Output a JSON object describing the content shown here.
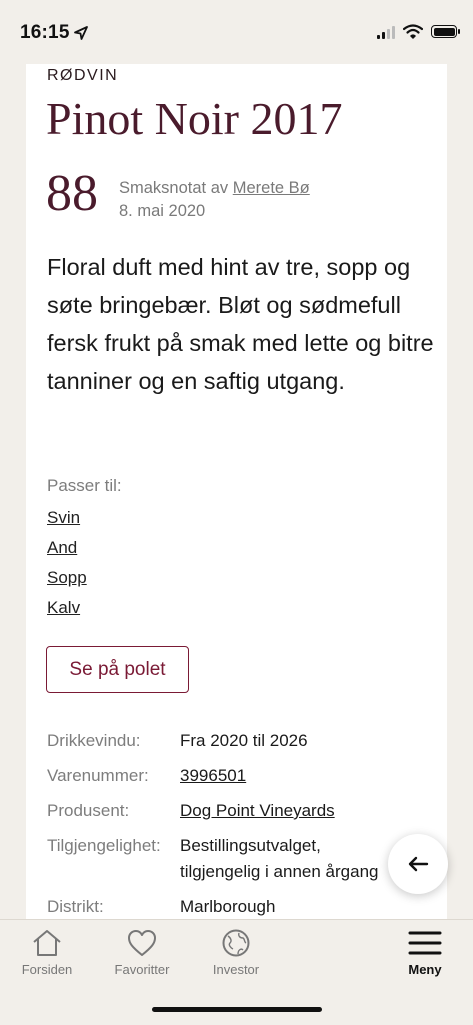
{
  "status_bar": {
    "time": "16:15"
  },
  "wine": {
    "category": "RØDVIN",
    "title": "Pinot Noir 2017",
    "score": "88",
    "note_prefix": "Smaksnotat av",
    "author": "Merete Bø",
    "date": "8. mai 2020",
    "description": "Floral duft med hint av tre, sopp og søte bringebær. Bløt og sødmefull fersk frukt på smak med lette og bitre tanniner og en saftig utgang."
  },
  "pairs": {
    "label": "Passer til:",
    "items": [
      "Svin",
      "And",
      "Sopp",
      "Kalv"
    ]
  },
  "polet_button": "Se på polet",
  "details": {
    "drikkevindu_label": "Drikkevindu:",
    "drikkevindu_value": "Fra 2020 til 2026",
    "varenummer_label": "Varenummer:",
    "varenummer_value": "3996501",
    "produsent_label": "Produsent:",
    "produsent_value": "Dog Point Vineyards",
    "tilgjengelighet_label": "Tilgjengelighet:",
    "tilgjengelighet_line1": "Bestillingsutvalget,",
    "tilgjengelighet_line2": "tilgjengelig i annen årgang",
    "distrikt_label": "Distrikt:",
    "distrikt_value": "Marlborough"
  },
  "tabs": [
    {
      "label": "Forsiden",
      "icon": "home-icon",
      "active": false
    },
    {
      "label": "Favoritter",
      "icon": "heart-icon",
      "active": false
    },
    {
      "label": "Investor",
      "icon": "globe-icon",
      "active": false
    },
    {
      "label": "Meny",
      "icon": "menu-icon",
      "active": true
    }
  ],
  "colors": {
    "accent": "#7a1a35",
    "title": "#4a1b2c",
    "background": "#f2efea"
  }
}
